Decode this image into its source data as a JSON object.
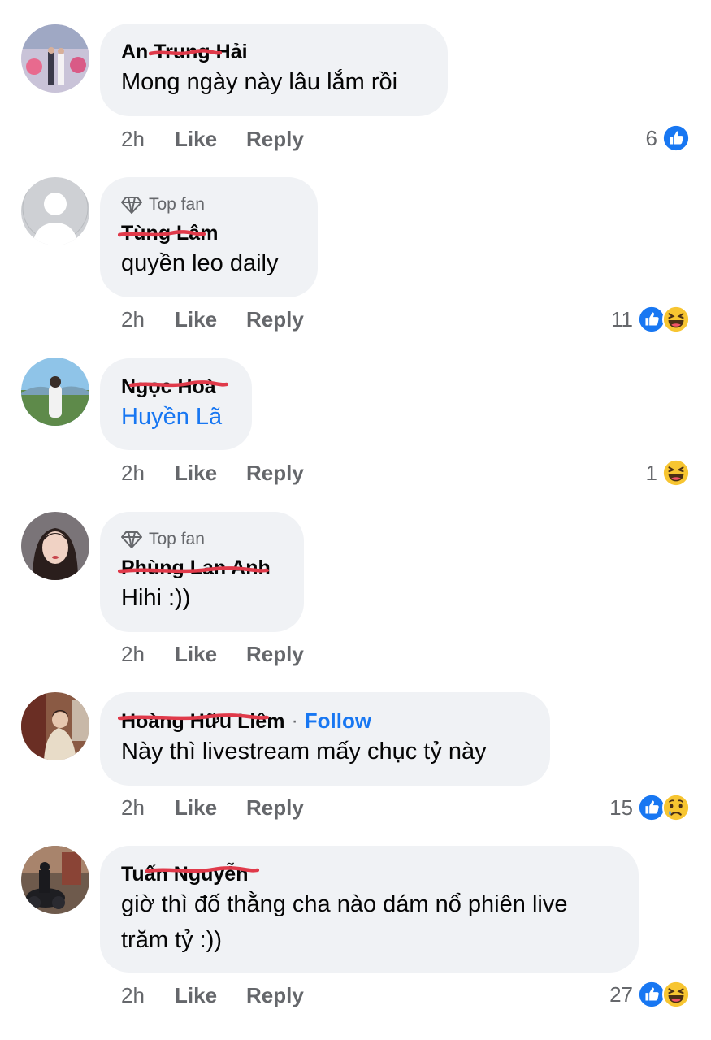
{
  "colors": {
    "bubble": "#f0f2f5",
    "link": "#1877f2",
    "meta": "#65676b",
    "redaction": "#e03a4a"
  },
  "comments": [
    {
      "name": "An Trung Hải",
      "text": "Mong ngày này lâu lắm rồi",
      "time": "2h",
      "like": "Like",
      "reply": "Reply",
      "reaction_count": "6",
      "reactions": [
        "like-icon"
      ]
    },
    {
      "badge": "Top fan",
      "name": "Tùng Lâm",
      "text": "quyền leo daily",
      "time": "2h",
      "like": "Like",
      "reply": "Reply",
      "reaction_count": "11",
      "reactions": [
        "like-icon",
        "haha-icon"
      ]
    },
    {
      "name": "Ngọc Hoà",
      "mention": "Huyền Lã",
      "time": "2h",
      "like": "Like",
      "reply": "Reply",
      "reaction_count": "1",
      "reactions": [
        "haha-icon"
      ]
    },
    {
      "badge": "Top fan",
      "name": "Phùng Lan Anh",
      "text": "Hihi :))",
      "time": "2h",
      "like": "Like",
      "reply": "Reply"
    },
    {
      "name": "Hoàng Hữu Liêm",
      "follow": "Follow",
      "separator": "·",
      "text": "Này thì livestream mấy chục tỷ này",
      "time": "2h",
      "like": "Like",
      "reply": "Reply",
      "reaction_count": "15",
      "reactions": [
        "like-icon",
        "sad-icon"
      ]
    },
    {
      "name": "Tuấn Nguyễn",
      "text_line1": "giờ thì đố thằng cha nào dám nổ phiên live",
      "text_line2": "trăm tỷ :))",
      "time": "2h",
      "like": "Like",
      "reply": "Reply",
      "reaction_count": "27",
      "reactions": [
        "like-icon",
        "haha-icon"
      ]
    }
  ]
}
